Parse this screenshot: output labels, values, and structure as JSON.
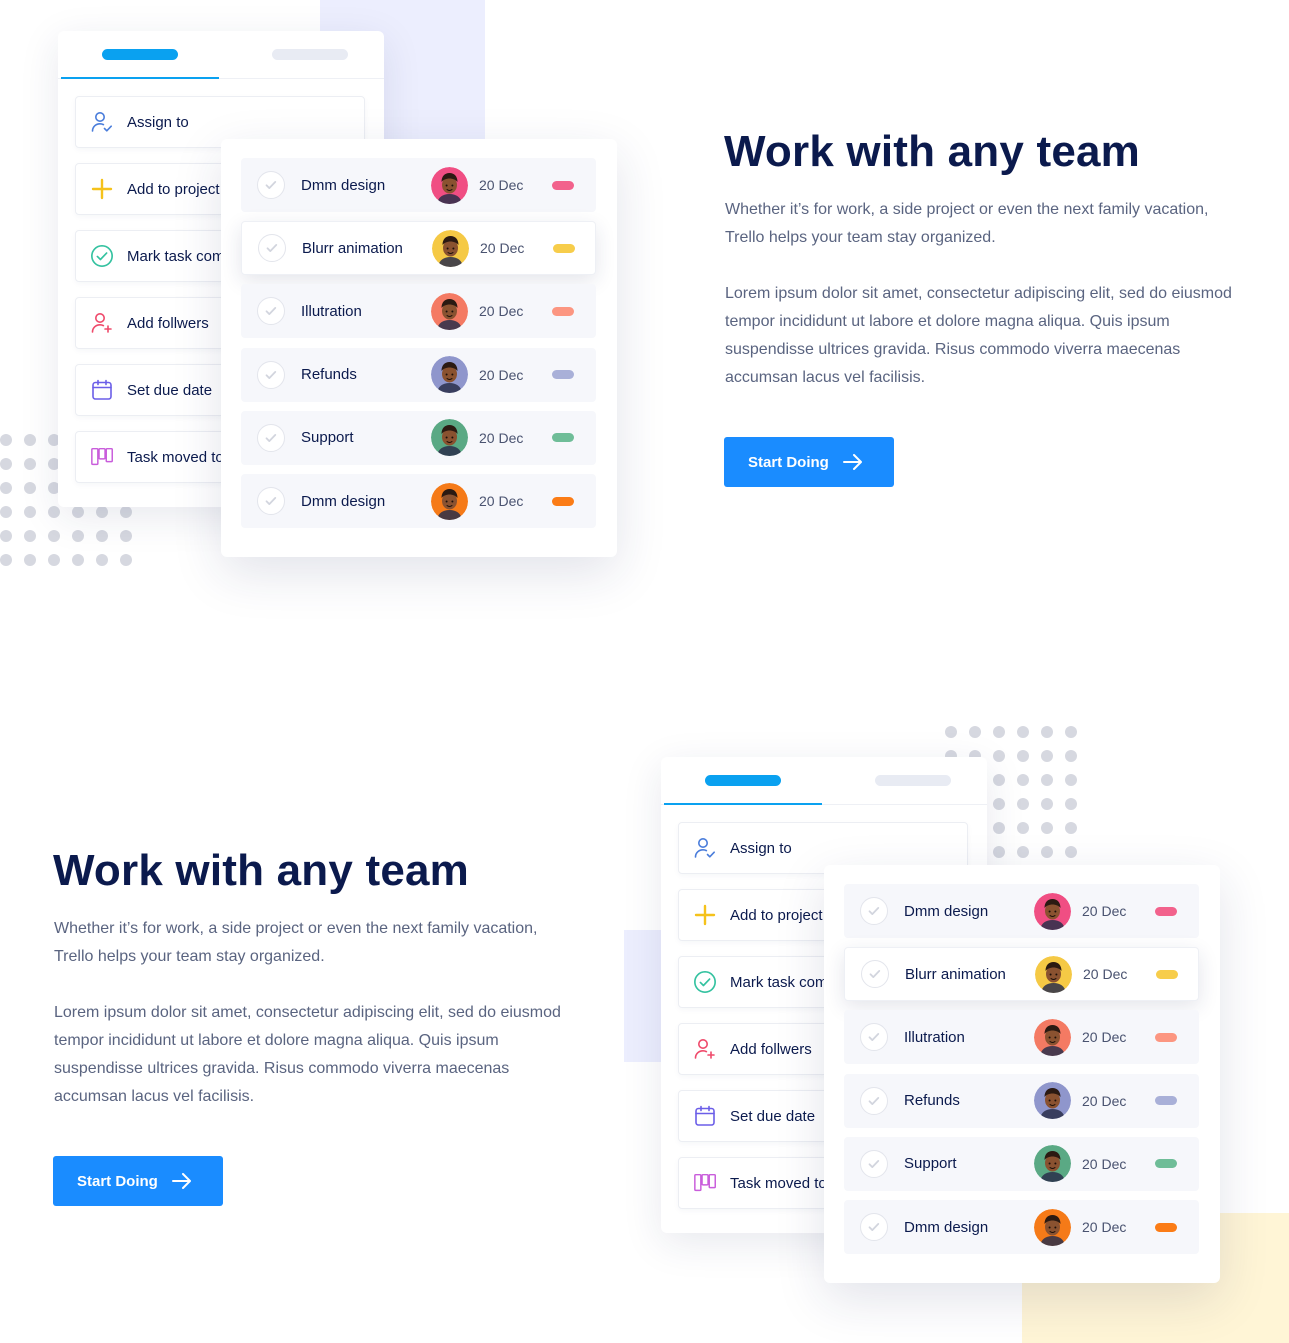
{
  "colors": {
    "accent": "#1a8cff",
    "tab_active": "#0aa1f0",
    "heading": "#0b1a4d",
    "body_text": "#5a6480",
    "tag_pink": "#f2628c",
    "tag_yellow": "#f7cd4b",
    "tag_salmon": "#fc9681",
    "tag_lavender": "#a9b0d8",
    "tag_green": "#6fbd98",
    "tag_orange": "#fb7c16"
  },
  "actions": [
    {
      "label": "Assign to",
      "icon": "user-check-icon"
    },
    {
      "label": "Add to project",
      "icon": "plus-icon"
    },
    {
      "label": "Mark task complete",
      "icon": "check-circle-icon"
    },
    {
      "label": "Add follwers",
      "icon": "user-plus-icon"
    },
    {
      "label": "Set due date",
      "icon": "calendar-icon"
    },
    {
      "label": "Task moved to",
      "icon": "board-icon"
    }
  ],
  "tasks": [
    {
      "name": "Dmm design",
      "date": "20 Dec",
      "tag_color": "#f2628c",
      "avatar_bg": "#f04e83",
      "highlighted": false
    },
    {
      "name": "Blurr animation",
      "date": "20 Dec",
      "tag_color": "#f7cd4b",
      "avatar_bg": "#f5c945",
      "highlighted": true
    },
    {
      "name": "Illutration",
      "date": "20 Dec",
      "tag_color": "#fc9681",
      "avatar_bg": "#f47a63",
      "highlighted": false
    },
    {
      "name": "Refunds",
      "date": "20 Dec",
      "tag_color": "#a9b0d8",
      "avatar_bg": "#8f96cc",
      "highlighted": false
    },
    {
      "name": "Support",
      "date": "20 Dec",
      "tag_color": "#6fbd98",
      "avatar_bg": "#5aa984",
      "highlighted": false
    },
    {
      "name": "Dmm design",
      "date": "20 Dec",
      "tag_color": "#fb7c16",
      "avatar_bg": "#f57a18",
      "highlighted": false
    }
  ],
  "section1": {
    "heading": "Work with any team",
    "intro": "Whether it’s for work, a side project or even the next family vacation, Trello helps your team stay organized.",
    "body": "Lorem ipsum dolor sit amet, consectetur adipiscing elit, sed do eiusmod tempor incididunt ut labore et dolore magna aliqua. Quis ipsum suspendisse ultrices gravida. Risus commodo viverra maecenas accumsan lacus vel facilisis.",
    "button_label": "Start Doing"
  },
  "section2": {
    "heading": "Work with any team",
    "intro": "Whether it’s for work, a side project or even the next family vacation, Trello helps your team stay organized.",
    "body": "Lorem ipsum dolor sit amet, consectetur adipiscing elit, sed do eiusmod tempor incididunt ut labore et dolore magna aliqua. Quis ipsum suspendisse ultrices gravida. Risus commodo viverra maecenas accumsan lacus vel facilisis.",
    "button_label": "Start Doing"
  }
}
